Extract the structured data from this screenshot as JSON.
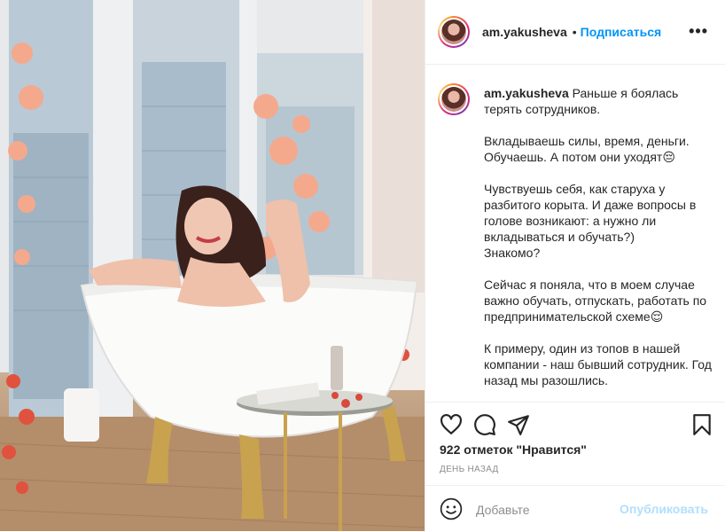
{
  "post": {
    "username": "am.yakusheva",
    "separator": "•",
    "follow_label": "Подписаться",
    "more_label": "•••",
    "caption": {
      "username": "am.yakusheva",
      "first": "Раньше я боялась терять сотрудников.",
      "paragraphs": [
        "Вкладываешь силы, время, деньги. Обучаешь. А потом они уходят😔",
        "Чувствуешь себя, как старуха у разбитого корыта. И даже вопросы в голове возникают: а нужно ли вкладываться и обучать?)\nЗнакомо?",
        "Сейчас я поняла, что в моем случае важно обучать, отпускать, работать по предпринимательской схеме😌",
        "К примеру, один из топов в нашей компании - наш бывший сотрудник. Год назад мы разошлись."
      ]
    },
    "likes_text": "922 отметок \"Нравится\"",
    "timestamp": "ДЕНЬ НАЗАД",
    "comment": {
      "placeholder": "Добавьте",
      "publish_label": "Опубликовать"
    },
    "icons": [
      "heart-icon",
      "comment-icon",
      "share-icon",
      "bookmark-icon",
      "emoji-icon",
      "more-icon"
    ],
    "colors": {
      "link": "#0095f6",
      "publish_disabled": "#b2dffc",
      "muted": "#8e8e8e",
      "text": "#262626"
    }
  }
}
